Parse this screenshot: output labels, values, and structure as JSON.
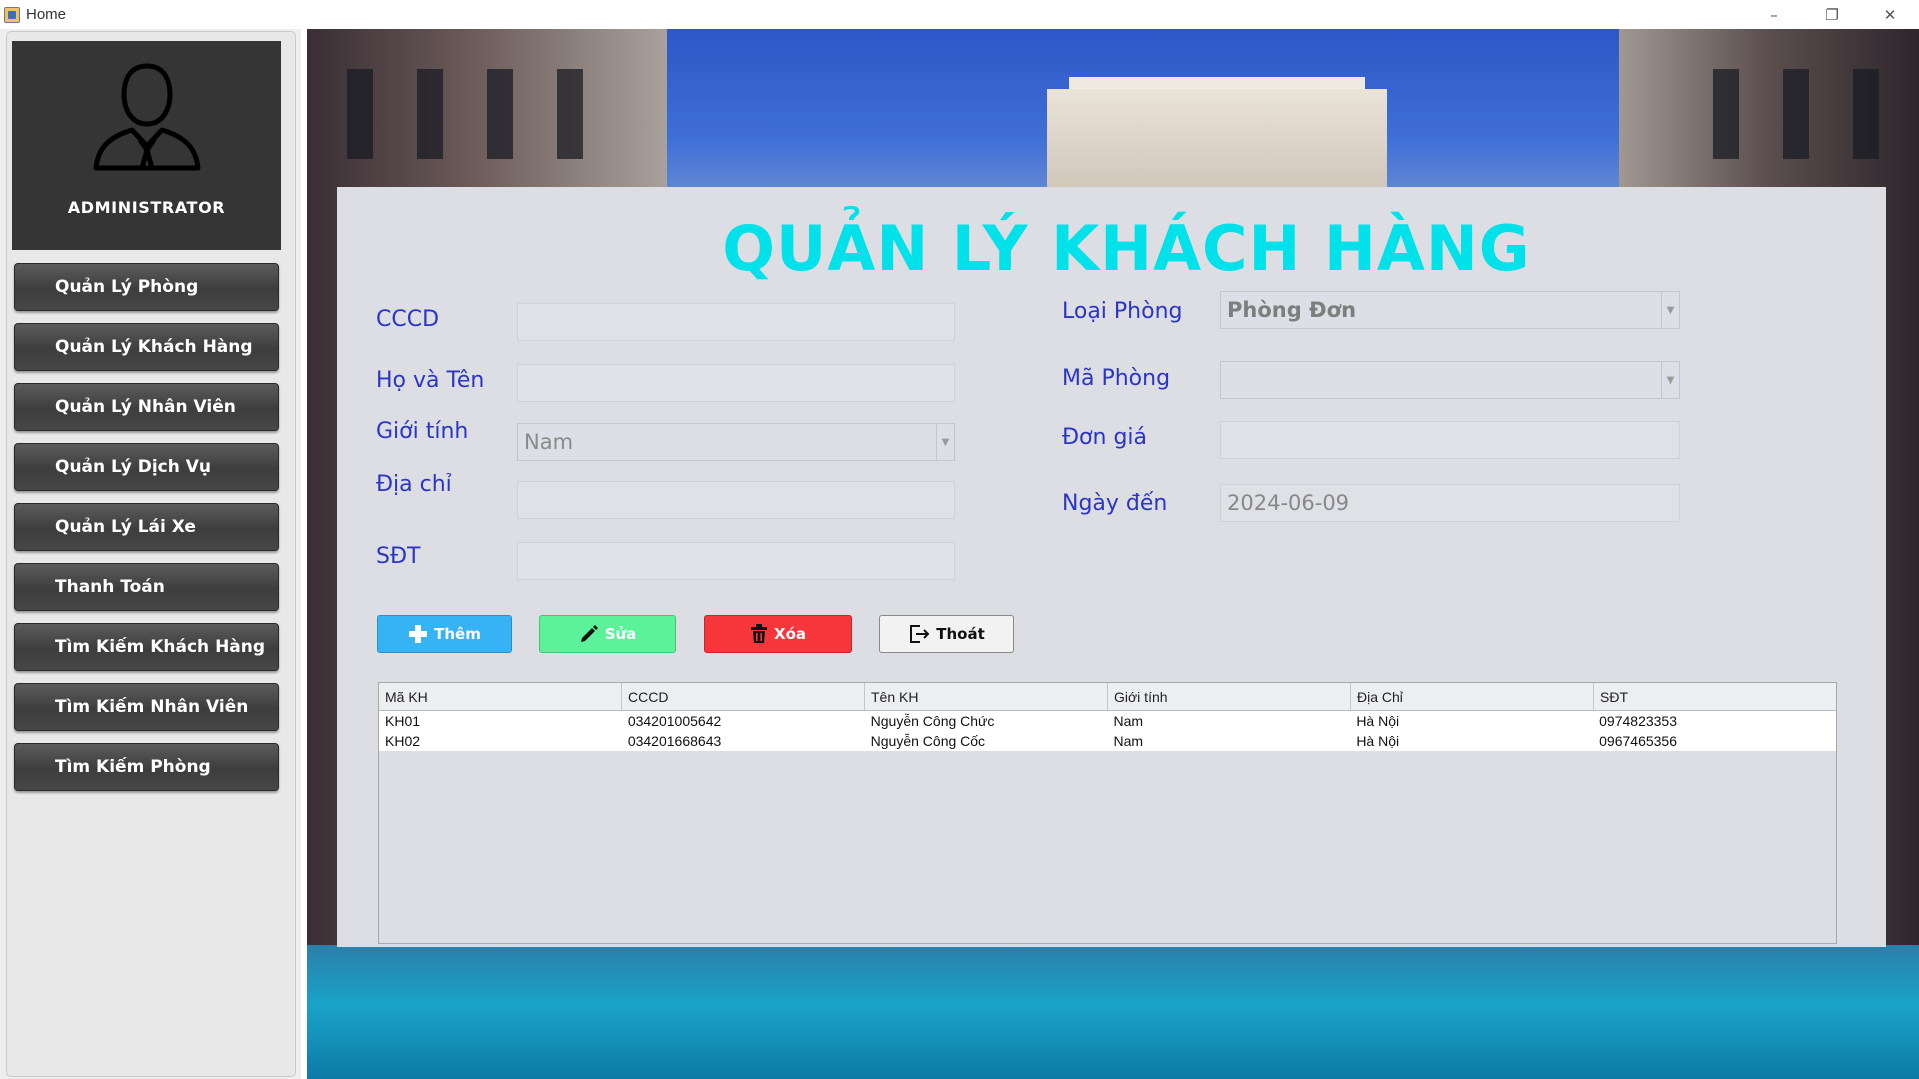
{
  "window": {
    "title": "Home",
    "minimize": "–",
    "restore": "❐",
    "close": "✕"
  },
  "sidebar": {
    "profile_label": "ADMINISTRATOR",
    "items": [
      {
        "label": "Quản Lý Phòng"
      },
      {
        "label": "Quản Lý Khách Hàng"
      },
      {
        "label": "Quản Lý Nhân Viên"
      },
      {
        "label": "Quản Lý Dịch Vụ"
      },
      {
        "label": "Quản Lý Lái Xe"
      },
      {
        "label": "Thanh Toán"
      },
      {
        "label": "Tìm Kiếm Khách Hàng"
      },
      {
        "label": "Tìm Kiếm Nhân Viên"
      },
      {
        "label": "Tìm Kiếm Phòng"
      }
    ]
  },
  "form": {
    "title": "QUẢN LÝ KHÁCH HÀNG",
    "labels": {
      "cccd": "CCCD",
      "ho_ten": "Họ và Tên",
      "gioi_tinh": "Giới tính",
      "dia_chi": "Địa chỉ",
      "sdt": "SĐT",
      "loai_phong": "Loại Phòng",
      "ma_phong": "Mã Phòng",
      "don_gia": "Đơn giá",
      "ngay_den": "Ngày đến"
    },
    "values": {
      "cccd": "",
      "ho_ten": "",
      "gioi_tinh": "Nam",
      "dia_chi": "",
      "sdt": "",
      "loai_phong": "Phòng Đơn",
      "ma_phong": "",
      "don_gia": "",
      "ngay_den": "2024-06-09"
    }
  },
  "buttons": {
    "them": "Thêm",
    "sua": "Sửa",
    "xoa": "Xóa",
    "thoat": "Thoát"
  },
  "colors": {
    "title": "#00e1ea",
    "label": "#2a35c8",
    "them_bg": "#36b3f5",
    "sua_bg": "#5cf29a",
    "xoa_bg": "#f7363b",
    "thoat_bg": "#f2f2f2"
  },
  "table": {
    "columns": [
      "Mã KH",
      "CCCD",
      "Tên KH",
      "Giới tính",
      "Địa Chỉ",
      "SĐT"
    ],
    "rows": [
      [
        "KH01",
        "034201005642",
        "Nguyễn Công Chức",
        "Nam",
        "Hà Nội",
        "0974823353"
      ],
      [
        "KH02",
        "034201668643",
        "Nguyễn Công Cốc",
        "Nam",
        "Hà Nội",
        "0967465356"
      ]
    ]
  }
}
